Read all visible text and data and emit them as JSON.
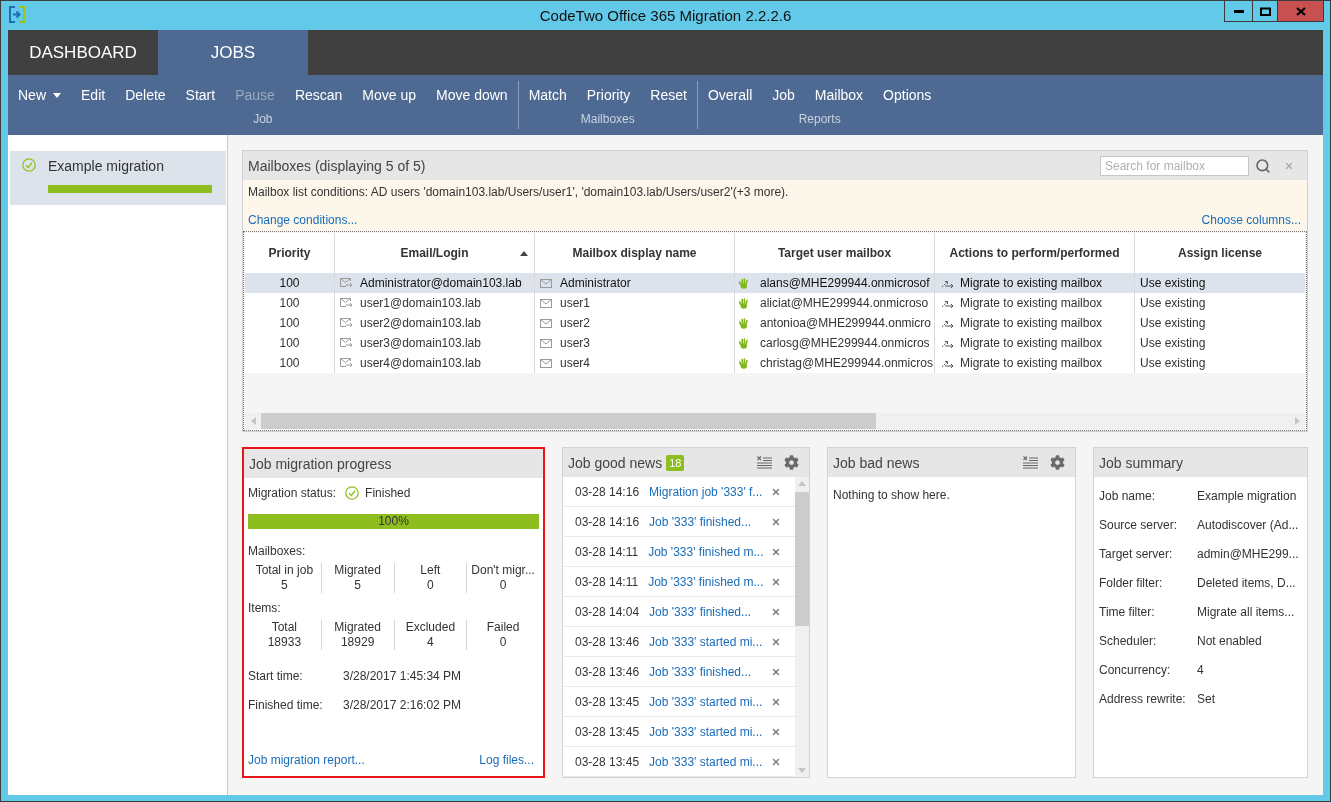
{
  "window": {
    "title": "CodeTwo Office 365 Migration 2.2.2.6"
  },
  "tabs": [
    {
      "label": "DASHBOARD",
      "selected": false
    },
    {
      "label": "JOBS",
      "selected": true
    }
  ],
  "toolbar": {
    "groups": [
      {
        "label": "Job",
        "buttons": [
          {
            "label": "New",
            "dropdown": true,
            "disabled": false
          },
          {
            "label": "Edit",
            "dropdown": false,
            "disabled": false
          },
          {
            "label": "Delete",
            "dropdown": false,
            "disabled": false
          },
          {
            "label": "Start",
            "dropdown": false,
            "disabled": false
          },
          {
            "label": "Pause",
            "dropdown": false,
            "disabled": true
          },
          {
            "label": "Rescan",
            "dropdown": false,
            "disabled": false
          },
          {
            "label": "Move up",
            "dropdown": false,
            "disabled": false
          },
          {
            "label": "Move down",
            "dropdown": false,
            "disabled": false
          }
        ]
      },
      {
        "label": "Mailboxes",
        "buttons": [
          {
            "label": "Match",
            "dropdown": false,
            "disabled": false
          },
          {
            "label": "Priority",
            "dropdown": false,
            "disabled": false
          },
          {
            "label": "Reset",
            "dropdown": false,
            "disabled": false
          }
        ]
      },
      {
        "label": "Reports",
        "buttons": [
          {
            "label": "Overall",
            "dropdown": false,
            "disabled": false
          },
          {
            "label": "Job",
            "dropdown": false,
            "disabled": false
          },
          {
            "label": "Mailbox",
            "dropdown": false,
            "disabled": false
          },
          {
            "label": "Options",
            "dropdown": false,
            "disabled": false
          }
        ]
      }
    ]
  },
  "sidebar": {
    "items": [
      {
        "label": "Example migration",
        "selected": true,
        "level": 1
      }
    ]
  },
  "mailboxes": {
    "title": "Mailboxes (displaying 5 of 5)",
    "search": {
      "placeholder": "Search for mailbox"
    },
    "conditions": "Mailbox list conditions: AD users 'domain103.lab/Users/user1', 'domain103.lab/Users/user2'(+3 more).",
    "change_conditions": "Change conditions...",
    "choose_columns": "Choose columns...",
    "table": {
      "columns": [
        {
          "label": "Priority",
          "kind": "number",
          "sorted": false
        },
        {
          "label": "Email/Login",
          "kind": "email",
          "sorted": true
        },
        {
          "label": "Mailbox display name",
          "kind": "mailbox",
          "sorted": false
        },
        {
          "label": "Target user mailbox",
          "kind": "target",
          "sorted": false
        },
        {
          "label": "Actions to perform/performed",
          "kind": "action",
          "sorted": false
        },
        {
          "label": "Assign license",
          "kind": "text",
          "sorted": false
        }
      ],
      "rows": [
        {
          "selected": true,
          "cells": [
            "100",
            "Administrator@domain103.lab",
            "Administrator",
            "alans@MHE299944.onmicrosof",
            "Migrate to existing mailbox",
            "Use existing"
          ]
        },
        {
          "selected": false,
          "cells": [
            "100",
            "user1@domain103.lab",
            "user1",
            "aliciat@MHE299944.onmicroso",
            "Migrate to existing mailbox",
            "Use existing"
          ]
        },
        {
          "selected": false,
          "cells": [
            "100",
            "user2@domain103.lab",
            "user2",
            "antonioa@MHE299944.onmicro",
            "Migrate to existing mailbox",
            "Use existing"
          ]
        },
        {
          "selected": false,
          "cells": [
            "100",
            "user3@domain103.lab",
            "user3",
            "carlosg@MHE299944.onmicros",
            "Migrate to existing mailbox",
            "Use existing"
          ]
        },
        {
          "selected": false,
          "cells": [
            "100",
            "user4@domain103.lab",
            "user4",
            "christag@MHE299944.onmicros",
            "Migrate to existing mailbox",
            "Use existing"
          ]
        }
      ]
    }
  },
  "progress": {
    "title": "Job migration progress",
    "highlighted": true,
    "status_label": "Migration status:",
    "status": "Finished",
    "level": 1,
    "reading": "100%",
    "mailboxes_label": "Mailboxes:",
    "mailbox_stats": [
      {
        "label": "Total in job",
        "value": "5"
      },
      {
        "label": "Migrated",
        "value": "5"
      },
      {
        "label": "Left",
        "value": "0"
      },
      {
        "label": "Don't migr...",
        "value": "0"
      }
    ],
    "items_label": "Items:",
    "item_stats": [
      {
        "label": "Total",
        "value": "18933"
      },
      {
        "label": "Migrated",
        "value": "18929"
      },
      {
        "label": "Excluded",
        "value": "4"
      },
      {
        "label": "Failed",
        "value": "0"
      }
    ],
    "times": [
      {
        "label": "Start time:",
        "value": "3/28/2017 1:45:34 PM"
      },
      {
        "label": "Finished time:",
        "value": "3/28/2017 2:16:02 PM"
      }
    ],
    "links": [
      "Job migration report...",
      "Log files..."
    ]
  },
  "good_news": {
    "title": "Job good news",
    "count": "18",
    "entries": [
      {
        "time": "03-28 14:16",
        "text": "Migration job '333' f..."
      },
      {
        "time": "03-28 14:16",
        "text": "Job '333' finished..."
      },
      {
        "time": "03-28 14:11",
        "text": "Job '333' finished m..."
      },
      {
        "time": "03-28 14:11",
        "text": "Job '333' finished m..."
      },
      {
        "time": "03-28 14:04",
        "text": "Job '333' finished..."
      },
      {
        "time": "03-28 13:46",
        "text": "Job '333' started mi..."
      },
      {
        "time": "03-28 13:46",
        "text": "Job '333' finished..."
      },
      {
        "time": "03-28 13:45",
        "text": "Job '333' started mi..."
      },
      {
        "time": "03-28 13:45",
        "text": "Job '333' started mi..."
      },
      {
        "time": "03-28 13:45",
        "text": "Job '333' started mi..."
      }
    ]
  },
  "bad_news": {
    "title": "Job bad news",
    "empty_text": "Nothing to show here."
  },
  "summary": {
    "title": "Job summary",
    "rows": [
      {
        "label": "Job name:",
        "value": "Example migration"
      },
      {
        "label": "Source server:",
        "value": "Autodiscover (Ad..."
      },
      {
        "label": "Target server:",
        "value": "admin@MHE299..."
      },
      {
        "label": "Folder filter:",
        "value": "Deleted items, D..."
      },
      {
        "label": "Time filter:",
        "value": "Migrate all items..."
      },
      {
        "label": "Scheduler:",
        "value": "Not enabled"
      },
      {
        "label": "Concurrency:",
        "value": "4"
      },
      {
        "label": "Address rewrite:",
        "value": "Set"
      }
    ]
  }
}
